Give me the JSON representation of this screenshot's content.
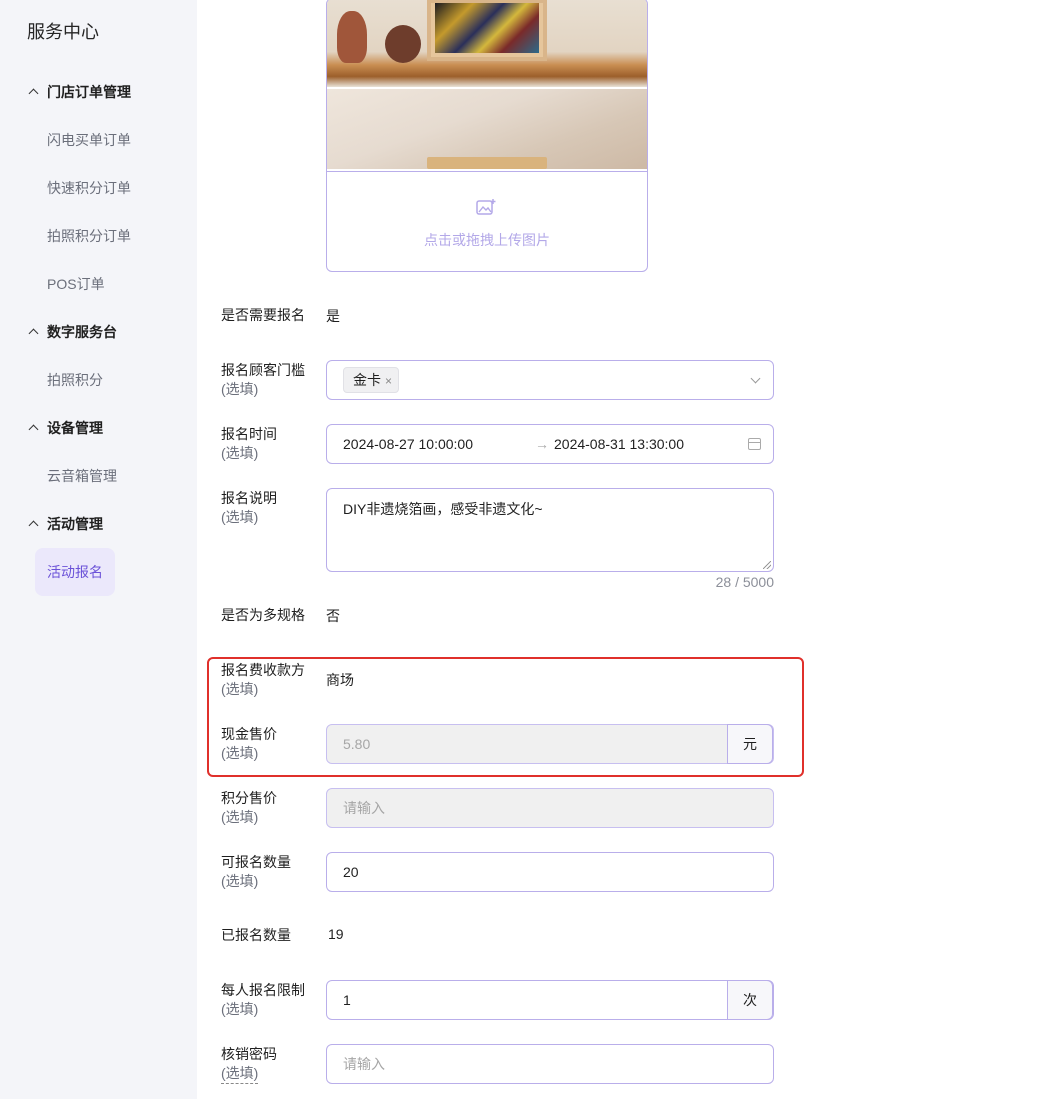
{
  "sidebar": {
    "title": "服务中心",
    "groups": [
      {
        "label": "门店订单管理",
        "items": [
          "闪电买单订单",
          "快速积分订单",
          "拍照积分订单",
          "POS订单"
        ]
      },
      {
        "label": "数字服务台",
        "items": [
          "拍照积分"
        ]
      },
      {
        "label": "设备管理",
        "items": [
          "云音箱管理"
        ]
      },
      {
        "label": "活动管理",
        "items": [
          "活动报名"
        ]
      }
    ],
    "active_item": "活动报名"
  },
  "upload": {
    "label": "点击或拖拽上传图片"
  },
  "form": {
    "optional_label": "(选填)",
    "need_signup": {
      "label": "是否需要报名",
      "value": "是"
    },
    "threshold": {
      "label": "报名顾客门槛",
      "tag": "金卡",
      "tag_close": "×"
    },
    "signup_time": {
      "label": "报名时间",
      "start": "2024-08-27 10:00:00",
      "separator": "→",
      "end": "2024-08-31 13:30:00"
    },
    "description": {
      "label": "报名说明",
      "value": "DIY非遗烧箔画，感受非遗文化~",
      "count": "28 / 5000"
    },
    "multi_spec": {
      "label": "是否为多规格",
      "value": "否"
    },
    "fee_receiver": {
      "label": "报名费收款方",
      "value": "商场"
    },
    "cash_price": {
      "label": "现金售价",
      "value": "5.80",
      "unit": "元"
    },
    "points_price": {
      "label": "积分售价",
      "placeholder": "请输入"
    },
    "capacity": {
      "label": "可报名数量",
      "value": "20"
    },
    "signed_count": {
      "label": "已报名数量",
      "value": "19"
    },
    "per_person_limit": {
      "label": "每人报名限制",
      "value": "1",
      "unit": "次"
    },
    "verify_password": {
      "label": "核销密码",
      "placeholder": "请输入"
    }
  },
  "colors": {
    "accent": "#6b52d8",
    "border": "#b9aeea",
    "highlight": "#e0302b"
  }
}
